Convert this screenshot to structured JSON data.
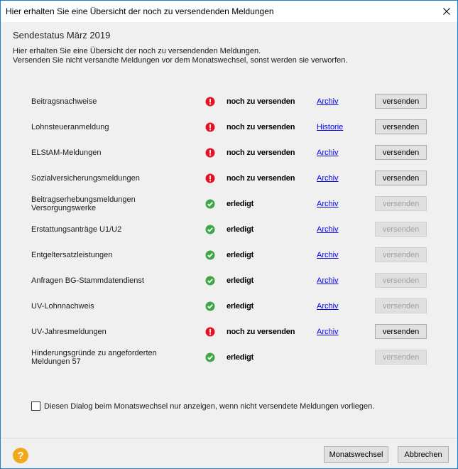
{
  "window": {
    "title": "Hier erhalten Sie eine Übersicht der noch zu versendenden Meldungen"
  },
  "header": {
    "heading": "Sendestatus März 2019",
    "intro_line1": "Hier erhalten Sie eine Übersicht der noch zu versendenden Meldungen.",
    "intro_line2": "Versenden Sie nicht versandte Meldungen vor dem Monatswechsel, sonst werden sie verworfen."
  },
  "rows": [
    {
      "label": "Beitragsnachweise",
      "status": "pending",
      "status_text": "noch zu versenden",
      "link": "Archiv",
      "button": "versenden",
      "button_enabled": true
    },
    {
      "label": "Lohnsteueranmeldung",
      "status": "pending",
      "status_text": "noch zu versenden",
      "link": "Historie",
      "button": "versenden",
      "button_enabled": true
    },
    {
      "label": "ELStAM-Meldungen",
      "status": "pending",
      "status_text": "noch zu versenden",
      "link": "Archiv",
      "button": "versenden",
      "button_enabled": true
    },
    {
      "label": "Sozialversicherungsmeldungen",
      "status": "pending",
      "status_text": "noch zu versenden",
      "link": "Archiv",
      "button": "versenden",
      "button_enabled": true
    },
    {
      "label": "Beitragserhebungsmeldungen Versorgungswerke",
      "status": "done",
      "status_text": "erledigt",
      "link": "Archiv",
      "button": "versenden",
      "button_enabled": false
    },
    {
      "label": "Erstattungsanträge U1/U2",
      "status": "done",
      "status_text": "erledigt",
      "link": "Archiv",
      "button": "versenden",
      "button_enabled": false
    },
    {
      "label": "Entgeltersatzleistungen",
      "status": "done",
      "status_text": "erledigt",
      "link": "Archiv",
      "button": "versenden",
      "button_enabled": false
    },
    {
      "label": "Anfragen BG-Stammdatendienst",
      "status": "done",
      "status_text": "erledigt",
      "link": "Archiv",
      "button": "versenden",
      "button_enabled": false
    },
    {
      "label": "UV-Lohnnachweis",
      "status": "done",
      "status_text": "erledigt",
      "link": "Archiv",
      "button": "versenden",
      "button_enabled": false
    },
    {
      "label": "UV-Jahresmeldungen",
      "status": "pending",
      "status_text": "noch zu versenden",
      "link": "Archiv",
      "button": "versenden",
      "button_enabled": true
    },
    {
      "label": "Hinderungsgründe zu angeforderten Meldungen 57",
      "status": "done",
      "status_text": "erledigt",
      "link": "",
      "button": "versenden",
      "button_enabled": false
    }
  ],
  "status_icons": {
    "pending": "error-icon",
    "done": "check-icon"
  },
  "colors": {
    "error": "#e81123",
    "success": "#3fa846",
    "help": "#f3a81c",
    "link": "#0000ee"
  },
  "checkbox": {
    "label": "Diesen Dialog beim Monatswechsel nur anzeigen, wenn nicht versendete Meldungen vorliegen.",
    "checked": false
  },
  "footer": {
    "primary_button": "Monatswechsel",
    "cancel_button": "Abbrechen"
  }
}
